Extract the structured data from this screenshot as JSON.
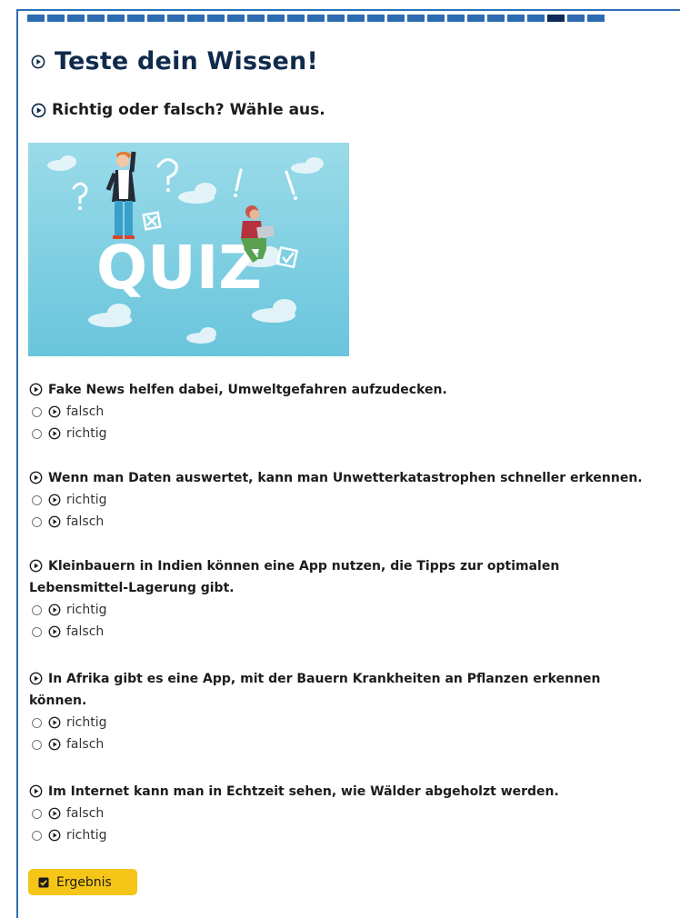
{
  "progress": {
    "total": 29,
    "active_index": 26
  },
  "header": {
    "title": "Teste dein Wissen!",
    "subtitle": "Richtig oder falsch? Wähle aus."
  },
  "image": {
    "caption_text": "QUIZ",
    "colors": {
      "sky_top": "#8fd6e6",
      "sky_bottom": "#6cc7dd"
    }
  },
  "questions": [
    {
      "text": "Fake News helfen dabei, Umweltgefahren aufzudecken.",
      "options": [
        "falsch",
        "richtig"
      ]
    },
    {
      "text": "Wenn man Daten auswertet, kann man Unwetterkatastrophen schneller erkennen.",
      "options": [
        "richtig",
        "falsch"
      ]
    },
    {
      "text": "Kleinbauern in Indien können eine App nutzen, die Tipps zur optimalen Lebensmittel-Lagerung gibt.",
      "options": [
        "richtig",
        "falsch"
      ]
    },
    {
      "text": "In Afrika gibt es eine App, mit der Bauern Krankheiten an Pflanzen erkennen können.",
      "options": [
        "richtig",
        "falsch"
      ]
    },
    {
      "text": "Im Internet kann man in Echtzeit sehen, wie Wälder abgeholzt werden.",
      "options": [
        "falsch",
        "richtig"
      ]
    }
  ],
  "result_button": {
    "label": "Ergebnis"
  },
  "colors": {
    "accent": "#2d6cb0",
    "accent_dark": "#0d2a57",
    "button": "#f5c518",
    "title": "#102a4c"
  }
}
